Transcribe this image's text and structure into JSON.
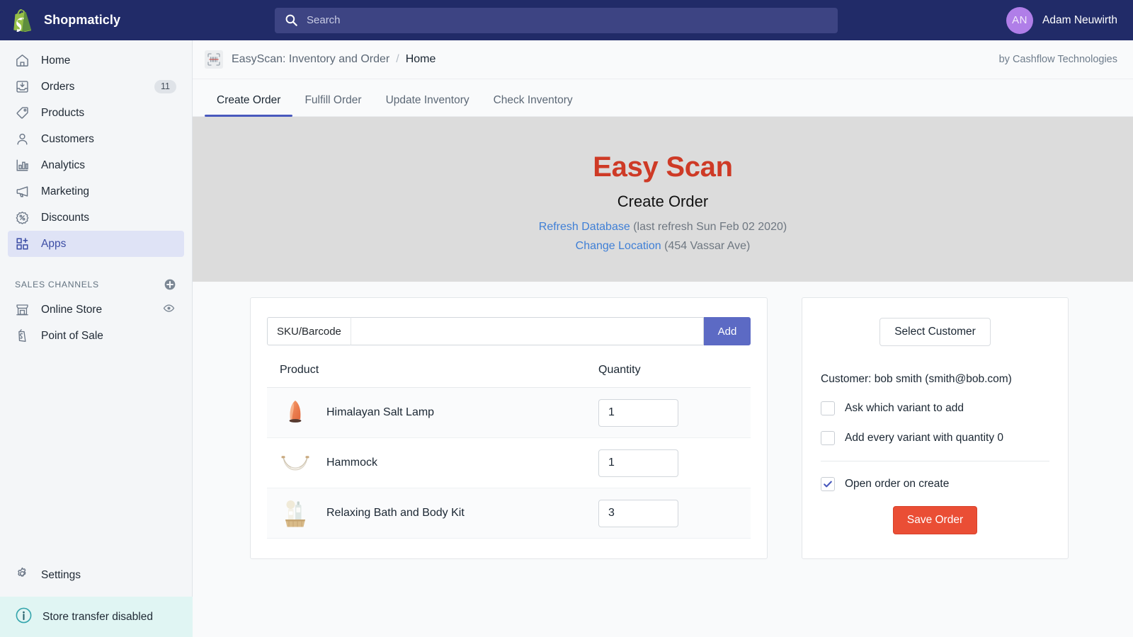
{
  "topbar": {
    "brand_name": "Shopmaticly",
    "logo_icon": "shopify-bag-icon",
    "search": {
      "icon": "search-icon",
      "placeholder": "Search",
      "value": ""
    },
    "user": {
      "initials": "AN",
      "name": "Adam Neuwirth"
    }
  },
  "sidebar": {
    "items": [
      {
        "label": "Home",
        "icon": "home-icon",
        "badge": "",
        "active": false
      },
      {
        "label": "Orders",
        "icon": "orders-inbox-icon",
        "badge": "11",
        "active": false
      },
      {
        "label": "Products",
        "icon": "price-tag-icon",
        "badge": "",
        "active": false
      },
      {
        "label": "Customers",
        "icon": "person-icon",
        "badge": "",
        "active": false
      },
      {
        "label": "Analytics",
        "icon": "bar-chart-icon",
        "badge": "",
        "active": false
      },
      {
        "label": "Marketing",
        "icon": "megaphone-icon",
        "badge": "",
        "active": false
      },
      {
        "label": "Discounts",
        "icon": "discount-badge-icon",
        "badge": "",
        "active": false
      },
      {
        "label": "Apps",
        "icon": "apps-grid-plus-icon",
        "badge": "",
        "active": true
      }
    ],
    "sales_channels": {
      "title": "SALES CHANNELS",
      "add_icon": "plus-circle-icon",
      "items": [
        {
          "label": "Online Store",
          "icon": "storefront-icon",
          "trailing_icon": "eye-icon"
        },
        {
          "label": "Point of Sale",
          "icon": "pos-bag-icon",
          "trailing_icon": ""
        }
      ]
    },
    "settings": {
      "label": "Settings",
      "icon": "gear-icon"
    },
    "store_banner": {
      "label": "Store transfer disabled",
      "icon": "info-circle-icon",
      "color": "#e0f5f3"
    }
  },
  "app_header": {
    "app_icon": "barcode-scanner-icon",
    "breadcrumb_app": "EasyScan: Inventory and Order",
    "breadcrumb_sep": "/",
    "breadcrumb_current": "Home",
    "by_line": "by Cashflow Technologies"
  },
  "tabs": [
    {
      "label": "Create Order",
      "active": true
    },
    {
      "label": "Fulfill Order",
      "active": false
    },
    {
      "label": "Update Inventory",
      "active": false
    },
    {
      "label": "Check Inventory",
      "active": false
    }
  ],
  "hero": {
    "title": "Easy Scan",
    "title_color": "#ce3a26",
    "subtitle": "Create Order",
    "refresh_link": "Refresh Database",
    "refresh_meta": " (last refresh Sun Feb 02 2020)",
    "location_link": "Change Location",
    "location_meta": " (454 Vassar Ave)",
    "link_color": "#3f7fd6",
    "background": "#dcdcdc"
  },
  "order_panel": {
    "sku_label": "SKU/Barcode",
    "sku_value": "",
    "sku_placeholder": "",
    "add_label": "Add",
    "add_color": "#5c6ac4",
    "columns": {
      "product": "Product",
      "quantity": "Quantity"
    },
    "rows": [
      {
        "name": "Himalayan Salt Lamp",
        "qty": "1",
        "thumb": "salt-lamp-thumbnail"
      },
      {
        "name": "Hammock",
        "qty": "1",
        "thumb": "hammock-thumbnail"
      },
      {
        "name": "Relaxing Bath and Body Kit",
        "qty": "3",
        "thumb": "bath-body-kit-thumbnail"
      }
    ]
  },
  "customer_panel": {
    "select_customer_label": "Select Customer",
    "customer_line": "Customer: bob smith (smith@bob.com)",
    "options": [
      {
        "label": "Ask which variant to add",
        "checked": false
      },
      {
        "label": "Add every variant with quantity 0",
        "checked": false
      },
      {
        "label": "Open order on create",
        "checked": true
      }
    ],
    "save_label": "Save Order",
    "save_color": "#ea4e35"
  }
}
